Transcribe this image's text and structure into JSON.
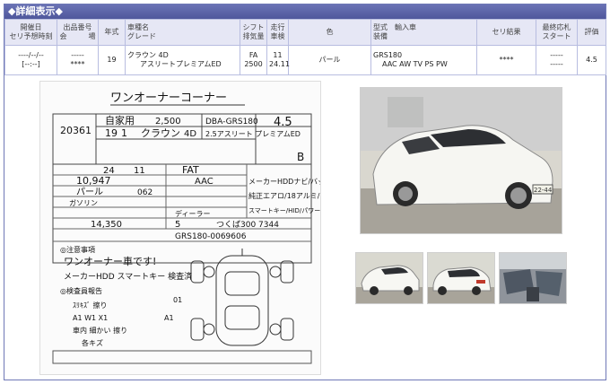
{
  "section_title": "◆詳細表示◆",
  "table": {
    "headers": {
      "date_l1": "開催日",
      "date_l2": "セリ予想時刻",
      "lot_l1": "出品番号",
      "lot_l2": "会　　　場",
      "year": "年式",
      "name_l1": "車種名",
      "name_l2": "グレード",
      "shift_l1": "シフト",
      "shift_l2": "排気量",
      "mileage_l1": "走行",
      "mileage_l2": "車検",
      "color": "色",
      "model_l1": "型式　輸入車",
      "model_l2": "装備",
      "result": "セリ結果",
      "final_l1": "最終応札",
      "final_l2": "スタート",
      "rating": "評価"
    },
    "row": {
      "date_l1": "----/--/--",
      "date_l2": "[--:--]",
      "lot_l1": "-----",
      "lot_l2": "****",
      "year": "19",
      "name_l1": "クラウン 4D",
      "name_l2": "アスリートプレミアムED",
      "shift_l1": "FA",
      "shift_l2": "2500",
      "mileage_l1": "11",
      "mileage_l2": "24.11",
      "color": "パール",
      "model_l1": "GRS180",
      "model_l2": "AAC AW TV PS PW",
      "result": "****",
      "final_l1": "-----",
      "final_l2": "-----",
      "rating": "4.5"
    }
  },
  "auction_sheet": {
    "title": "ワンオーナーコーナー",
    "lot_number": "20361",
    "use_type": "自家用",
    "displacement": "2,500",
    "model_code": "DBA-GRS180",
    "score": "4.5",
    "year": "19",
    "month": "1",
    "car_name": "クラウン",
    "doors": "4D",
    "grade": "2.5アスリート プレミアムED",
    "interior": "B",
    "reg_year": "24",
    "reg_month": "11",
    "shift": "FAT",
    "mileage": "10,947",
    "ac": "AAC",
    "color": "パール",
    "color_code": "062",
    "fuel": "ガソリン",
    "dealer": "ディーラー",
    "recycle_fee": "14,350",
    "capacity": "5",
    "chassis_number": "GRS180-0069606",
    "notes_equipment": "メーカーHDDナビ/バックカメラ/",
    "notes_parts": "純正エアロ/18アルミ/",
    "notes_keys": "スマートキー/HID/パワーシート/",
    "plate": "つくば300 7344",
    "note_one_owner": "ワンオーナー車です!",
    "note_tags": "メーカーHDD  スマートキー  検査済",
    "inspector_l1": "ｽﾘｷｽﾞ 擦り",
    "inspector_l2": "A1 W1 X1",
    "inspector_l3": "車内 細かい 擦り",
    "inspector_l4": "各キズ",
    "label_notes": "◎注意事項",
    "label_inspection": "◎検査員報告",
    "label_grade": "グレード"
  },
  "photos": {
    "main_plate": "22-44",
    "thumb_count": 3
  }
}
